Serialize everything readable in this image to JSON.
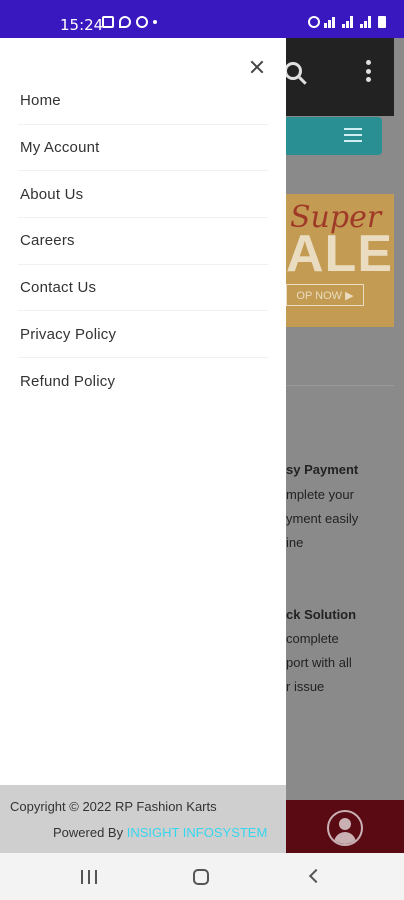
{
  "status_bar": {
    "time": "15:24",
    "left_icons": [
      "gallery-icon",
      "location-icon",
      "whatsapp-icon",
      "dot-icon"
    ],
    "right_icons": [
      "alarm-icon",
      "wifi-icon",
      "signal-icon",
      "signal-icon",
      "battery-icon"
    ]
  },
  "drawer": {
    "menu": [
      {
        "label": "Home"
      },
      {
        "label": "My Account"
      },
      {
        "label": "About Us"
      },
      {
        "label": "Careers"
      },
      {
        "label": "Contact Us"
      },
      {
        "label": "Privacy Policy"
      },
      {
        "label": "Refund Policy"
      }
    ],
    "footer": {
      "copyright": "Copyright © 2022 RP Fashion Karts",
      "powered_prefix": "Powered By ",
      "powered_link": "INSIGHT INFOSYSTEM"
    }
  },
  "background_app": {
    "banner": {
      "line1": "Super",
      "line2": "ALE",
      "button": "OP NOW ▶"
    },
    "features": [
      {
        "title": "sy Payment",
        "lines": [
          "mplete your",
          "yment easily",
          "ine"
        ]
      },
      {
        "title": "ck Solution",
        "lines": [
          "complete",
          "port with all",
          "r issue"
        ]
      }
    ]
  },
  "colors": {
    "status_bar": "#3a18c0",
    "drawer_footer": "#cfcfcf",
    "powered_link": "#36d6ee",
    "app_teal": "#2a8f93",
    "app_bottom": "#5a0a12"
  }
}
